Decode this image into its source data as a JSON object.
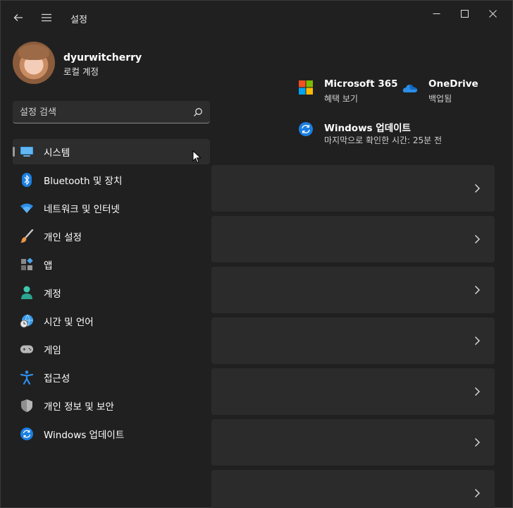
{
  "window": {
    "title": "설정",
    "back_icon": "back-arrow-icon",
    "menu_icon": "hamburger-menu-icon",
    "controls": [
      "minimize-icon",
      "maximize-icon",
      "close-icon"
    ]
  },
  "profile": {
    "name": "dyurwitcherry",
    "account_type": "로컬 계정"
  },
  "search": {
    "placeholder": "설정 검색",
    "icon": "search-icon"
  },
  "nav": {
    "selected": "시스템",
    "items": [
      {
        "label": "시스템",
        "icon": "monitor-icon"
      },
      {
        "label": "Bluetooth 및 장치",
        "icon": "bluetooth-icon"
      },
      {
        "label": "네트워크 및 인터넷",
        "icon": "wifi-icon"
      },
      {
        "label": "개인 설정",
        "icon": "paintbrush-icon"
      },
      {
        "label": "앱",
        "icon": "apps-icon"
      },
      {
        "label": "계정",
        "icon": "person-icon"
      },
      {
        "label": "시간 및 언어",
        "icon": "globe-clock-icon"
      },
      {
        "label": "게임",
        "icon": "gamepad-icon"
      },
      {
        "label": "접근성",
        "icon": "accessibility-icon"
      },
      {
        "label": "개인 정보 및 보안",
        "icon": "shield-icon"
      },
      {
        "label": "Windows 업데이트",
        "icon": "update-icon"
      }
    ]
  },
  "tiles": {
    "m365": {
      "title": "Microsoft 365",
      "subtitle": "혜택 보기",
      "icon": "microsoft-logo-icon"
    },
    "onedrive": {
      "title": "OneDrive",
      "subtitle": "백업됨",
      "icon": "onedrive-cloud-icon"
    },
    "update": {
      "title": "Windows 업데이트",
      "subtitle": "마지막으로 확인한 시간: 25분 전",
      "icon": "update-icon"
    }
  },
  "cards_count_visible": 7,
  "colors": {
    "background": "#202020",
    "card": "#2b2b2b",
    "accent_blue": "#0078d4",
    "text": "#ffffff"
  }
}
